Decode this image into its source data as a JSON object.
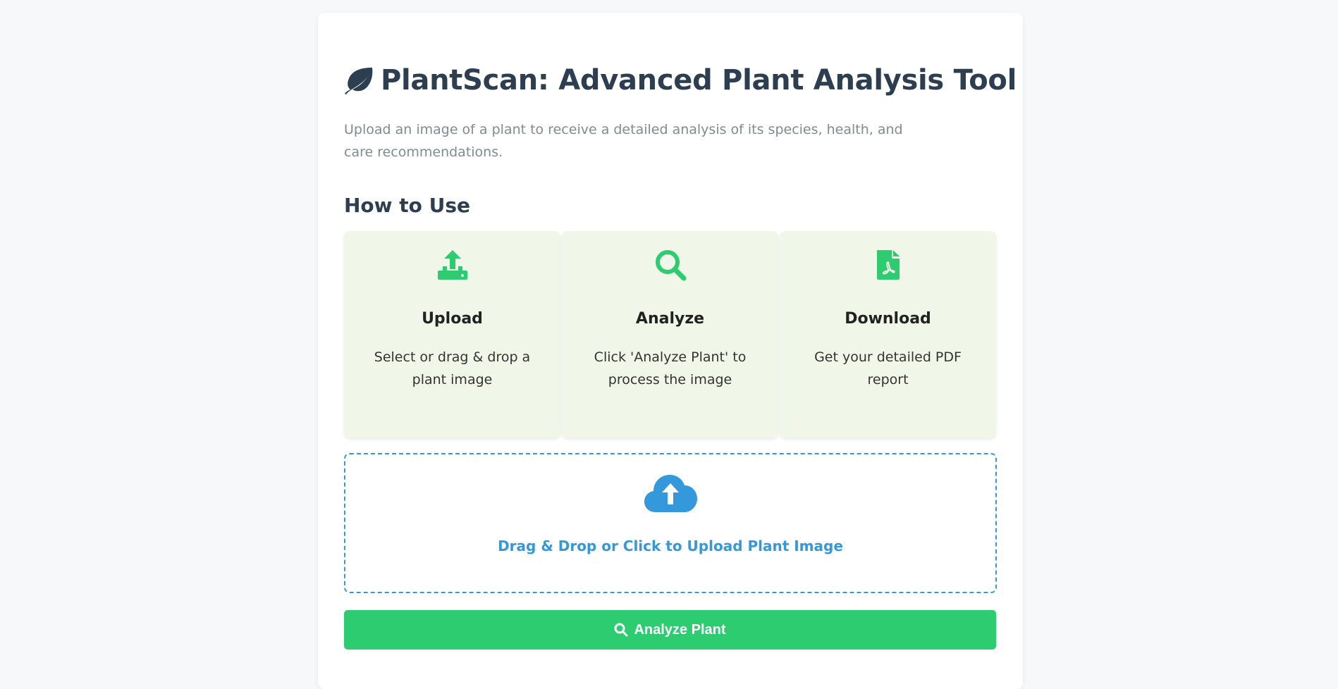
{
  "header": {
    "title": "PlantScan: Advanced Plant Analysis Tool",
    "title_icon": "leaf-icon",
    "subtitle": "Upload an image of a plant to receive a detailed analysis of its species, health, and care recommendations."
  },
  "how_to": {
    "heading": "How to Use",
    "steps": [
      {
        "icon": "upload-icon",
        "title": "Upload",
        "description": "Select or drag & drop a plant image"
      },
      {
        "icon": "search-icon",
        "title": "Analyze",
        "description": "Click 'Analyze Plant' to process the image"
      },
      {
        "icon": "pdf-file-icon",
        "title": "Download",
        "description": "Get your detailed PDF report"
      }
    ]
  },
  "upload": {
    "icon": "cloud-upload-icon",
    "label": "Drag & Drop or Click to Upload Plant Image"
  },
  "analyze_button": {
    "icon": "search-icon",
    "label": "Analyze Plant"
  },
  "colors": {
    "primary_text": "#2c3e50",
    "accent_green": "#2ecc71",
    "accent_blue": "#3498db",
    "step_card_bg": "#f0f6e8"
  }
}
